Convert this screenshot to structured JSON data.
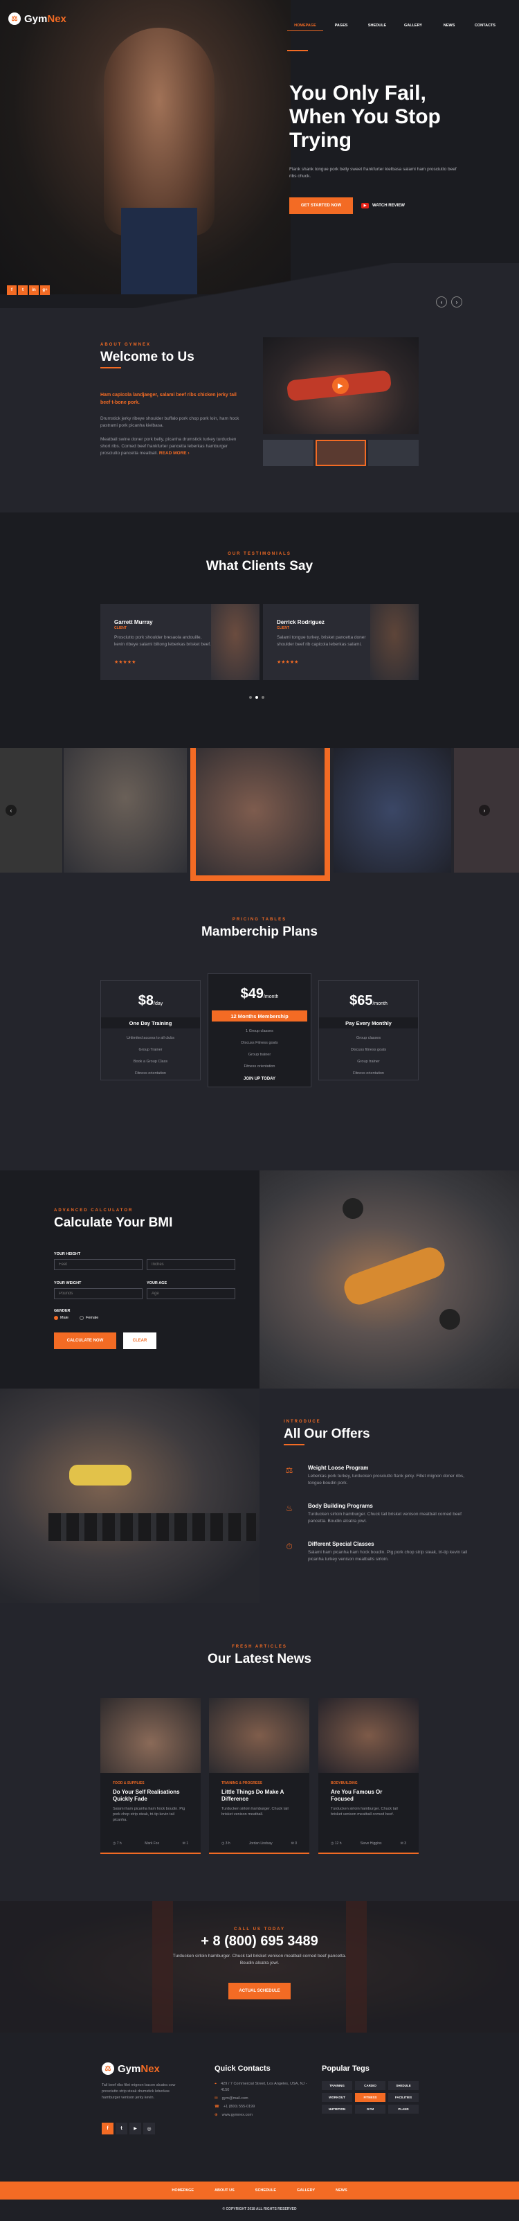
{
  "brand": {
    "name_a": "Gym",
    "name_b": "Nex",
    "accent": "#f36b24",
    "bg": "#24252c"
  },
  "nav": {
    "items": [
      "HOMEPAGE",
      "PAGES",
      "SHEDULE",
      "GALLERY",
      "NEWS",
      "CONTACTS"
    ],
    "active_index": 0
  },
  "hero": {
    "title_1": "You Only Fail,",
    "title_2": "When You Stop",
    "title_3": "Trying",
    "text": "Flank shank tongue pork belly sweet frankfurter kielbasa salami ham prosciutto beef ribs chuck.",
    "cta": "GET STARTED NOW",
    "video": "WATCH REVIEW",
    "social": [
      "f",
      "t",
      "in",
      "g+"
    ]
  },
  "about": {
    "kicker": "ABOUT GYMNEX",
    "title": "Welcome to Us",
    "lead": "Ham capicola landjaeger, salami beef ribs chicken jerky tail beef t-bone pork.",
    "p1": "Drumstick jerky ribeye shoulder buffalo pork chop pork loin, ham hock pastrami pork picanha kielbasa.",
    "p2": "Meatball swine doner pork belly, picanha drumstick turkey turducken short ribs. Corned beef frankfurter pancetta leberkas hamburger prosciutto pancetta meatball.",
    "more": "READ MORE ›"
  },
  "testimonials": {
    "kicker": "OUR TESTIMONIALS",
    "title": "What Clients Say",
    "items": [
      {
        "name": "Garrett Murray",
        "role": "CLIENT",
        "text": "Prosciutto pork shoulder bresaola andouille, kevin ribeye salami biltong leberkas brisket beef.",
        "stars": 5
      },
      {
        "name": "Derrick Rodriguez",
        "role": "CLIENT",
        "text": "Salami tongue turkey, brisket pancetta doner shoulder beef rib capicola leberkas salami.",
        "stars": 5
      }
    ]
  },
  "plans": {
    "kicker": "PRICING TABLES",
    "title": "Mamberchip Plans",
    "items": [
      {
        "price": "$8",
        "per": "/day",
        "name": "One Day Training",
        "features": [
          "Unlimited access to all clubs",
          "Group Trainer",
          "Book a Group Class",
          "Fitness orientation"
        ],
        "featured": false
      },
      {
        "price": "$49",
        "per": "/month",
        "name": "12 Months Membership",
        "features": [
          "1 Group classes",
          "Discuss Fitness goals",
          "Group trainer",
          "Fitness orientation"
        ],
        "featured": true,
        "join": "JOIN UP TODAY"
      },
      {
        "price": "$65",
        "per": "/month",
        "name": "Pay Every Monthly",
        "features": [
          "Group classes",
          "Discuss fitness goals",
          "Group trainer",
          "Fitness orientation"
        ],
        "featured": false
      }
    ]
  },
  "bmi": {
    "kicker": "ADVANCED CALCULATOR",
    "title": "Calculate Your BMI",
    "height_label": "YOUR HEIGHT",
    "height_ph": "Feet",
    "inches_ph": "Inches",
    "weight_label": "YOUR WEIGHT",
    "weight_ph": "Pounds",
    "age_label": "YOUR AGE",
    "age_ph": "Age",
    "gender_label": "GENDER",
    "male": "Male",
    "female": "Female",
    "submit": "CALCULATE NOW",
    "reset": "CLEAR"
  },
  "offers": {
    "kicker": "INTRODUCE",
    "title": "All Our Offers",
    "items": [
      {
        "title": "Weight Loose Program",
        "text": "Leberkas pork turkey, turducken prosciutto flank jerky. Fillet mignon doner ribs, tongue boudin pork."
      },
      {
        "title": "Body Building Programs",
        "text": "Turducken sirloin hamburger. Chuck tail brisket venison meatball corned beef pancetta. Boudin alcatra jowl."
      },
      {
        "title": "Different Special Classes",
        "text": "Salami ham picanha ham hock boudin. Pig pork chop strip steak, tri-tip kevin tail picanha turkey venison meatballs sirloin."
      }
    ]
  },
  "news": {
    "kicker": "FRESH ARTICLES",
    "title": "Our Latest News",
    "items": [
      {
        "cat": "FOOD & SUPPLIES",
        "title_1": "Do Your Self Realisations",
        "title_2": "Quickly Fade",
        "text": "Salami ham picanha ham hock boudin. Pig pork chop strip steak, tri-tip kevin tail picanha.",
        "time": "7 h",
        "author": "Mark Fox",
        "comments": "1"
      },
      {
        "cat": "TRAINING & PROGRESS",
        "title_1": "Little Things Do Make A",
        "title_2": "Difference",
        "text": "Turducken sirloin hamburger. Chuck tail brisket venison meatball.",
        "time": "3 h",
        "author": "Jordan Lindsay",
        "comments": "0"
      },
      {
        "cat": "BODYBUILDING",
        "title_1": "Are You Famous Or",
        "title_2": "Focused",
        "text": "Turducken sirloin hamburger. Chuck tail brisket venison meatball corned beef.",
        "time": "12 h",
        "author": "Steve Higgins",
        "comments": "3"
      }
    ]
  },
  "cta": {
    "kicker": "CALL US TODAY",
    "phone": "+ 8 (800) 695 3489",
    "text": "Turducken sirloin hamburger. Chuck tail brisket venison meatball corned beef pancetta. Boudin alcatra jowl.",
    "button": "ACTUAL SCHEDULE"
  },
  "footer": {
    "about": "Tail beef ribs filet mignon bacon alcatra cow prosciutto strip steak drumstick leberkas hamburger venison jerky kevin.",
    "contacts_title": "Quick Contacts",
    "address": "429 / 7 Commercial Street, Los Angeles, USA, NJ - 4150",
    "email": "gym@mail.com",
    "phone": "+1 (800) 555-0199",
    "site": "www.gymnex.com",
    "tags_title": "Popular Tegs",
    "tags": [
      "TRAINING",
      "CARDIO",
      "SHEDULE",
      "WORKOUT",
      "FITNESS",
      "FACILITIES",
      "NUTRITION",
      "GYM",
      "PLANS"
    ],
    "active_tag": 4,
    "links": [
      "HOMEPAGE",
      "ABOUT US",
      "SCHEDULE",
      "GALLERY",
      "NEWS"
    ],
    "copyright": "© COPYRIGHT 2018 ALL RIGHTS RESERVED"
  }
}
